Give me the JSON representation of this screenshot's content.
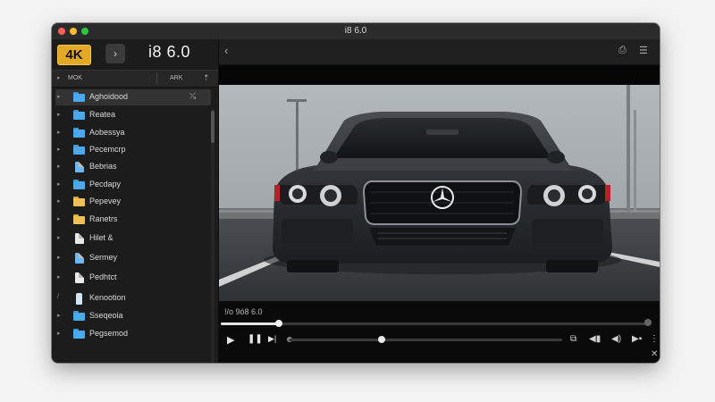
{
  "window": {
    "title": "i8 6.0"
  },
  "sidebar": {
    "badge": "4K",
    "nav_glyph": "›",
    "app_name": "i8 6.0",
    "col_left": "MOK",
    "col_right": "ARK",
    "sort_glyph": "⇡",
    "items": [
      {
        "label": "Aghoidood",
        "icon": "folder-icon",
        "disclosure": "▸",
        "pin": "⤯"
      },
      {
        "label": "Reatea",
        "icon": "folder-icon",
        "disclosure": "▸"
      },
      {
        "label": "Aobessya",
        "icon": "folder-icon",
        "disclosure": "▸"
      },
      {
        "label": "Pecemcrp",
        "icon": "folder-icon",
        "disclosure": "▸"
      },
      {
        "label": "Bebrias",
        "icon": "document-icon",
        "disclosure": "▸"
      },
      {
        "label": "Pecdapy",
        "icon": "folder-icon",
        "disclosure": "▸"
      },
      {
        "label": "Pepevey",
        "icon": "folder-icon-yellow",
        "disclosure": "▸"
      },
      {
        "label": "Ranetrs",
        "icon": "folder-icon-yellow",
        "disclosure": "▸"
      },
      {
        "label": "Hilet &",
        "icon": "document-icon",
        "disclosure": "▸"
      },
      {
        "label": "Sermey",
        "icon": "document-icon-blue",
        "disclosure": "▸"
      },
      {
        "label": "Pedhtct",
        "icon": "document-icon",
        "disclosure": "▸"
      },
      {
        "label": "Kenootion",
        "icon": "bottle-icon",
        "disclosure": "/"
      },
      {
        "label": "Sseqeoia",
        "icon": "folder-icon",
        "disclosure": "▸"
      },
      {
        "label": "Pegsemod",
        "icon": "folder-icon",
        "disclosure": "▸"
      }
    ]
  },
  "player": {
    "back_glyph": "‹",
    "share_glyph": "⎙",
    "menu_glyph": "☰",
    "time_label": "!/o 9ó8 6.0",
    "progress": 0.135,
    "play_glyph": "▶",
    "pause_glyph": "❚❚",
    "next_glyph": "▶|",
    "right_controls": [
      "⧉",
      "◀▮",
      "◀)",
      "▶▪",
      "⋮"
    ],
    "close_glyph": "✕"
  }
}
